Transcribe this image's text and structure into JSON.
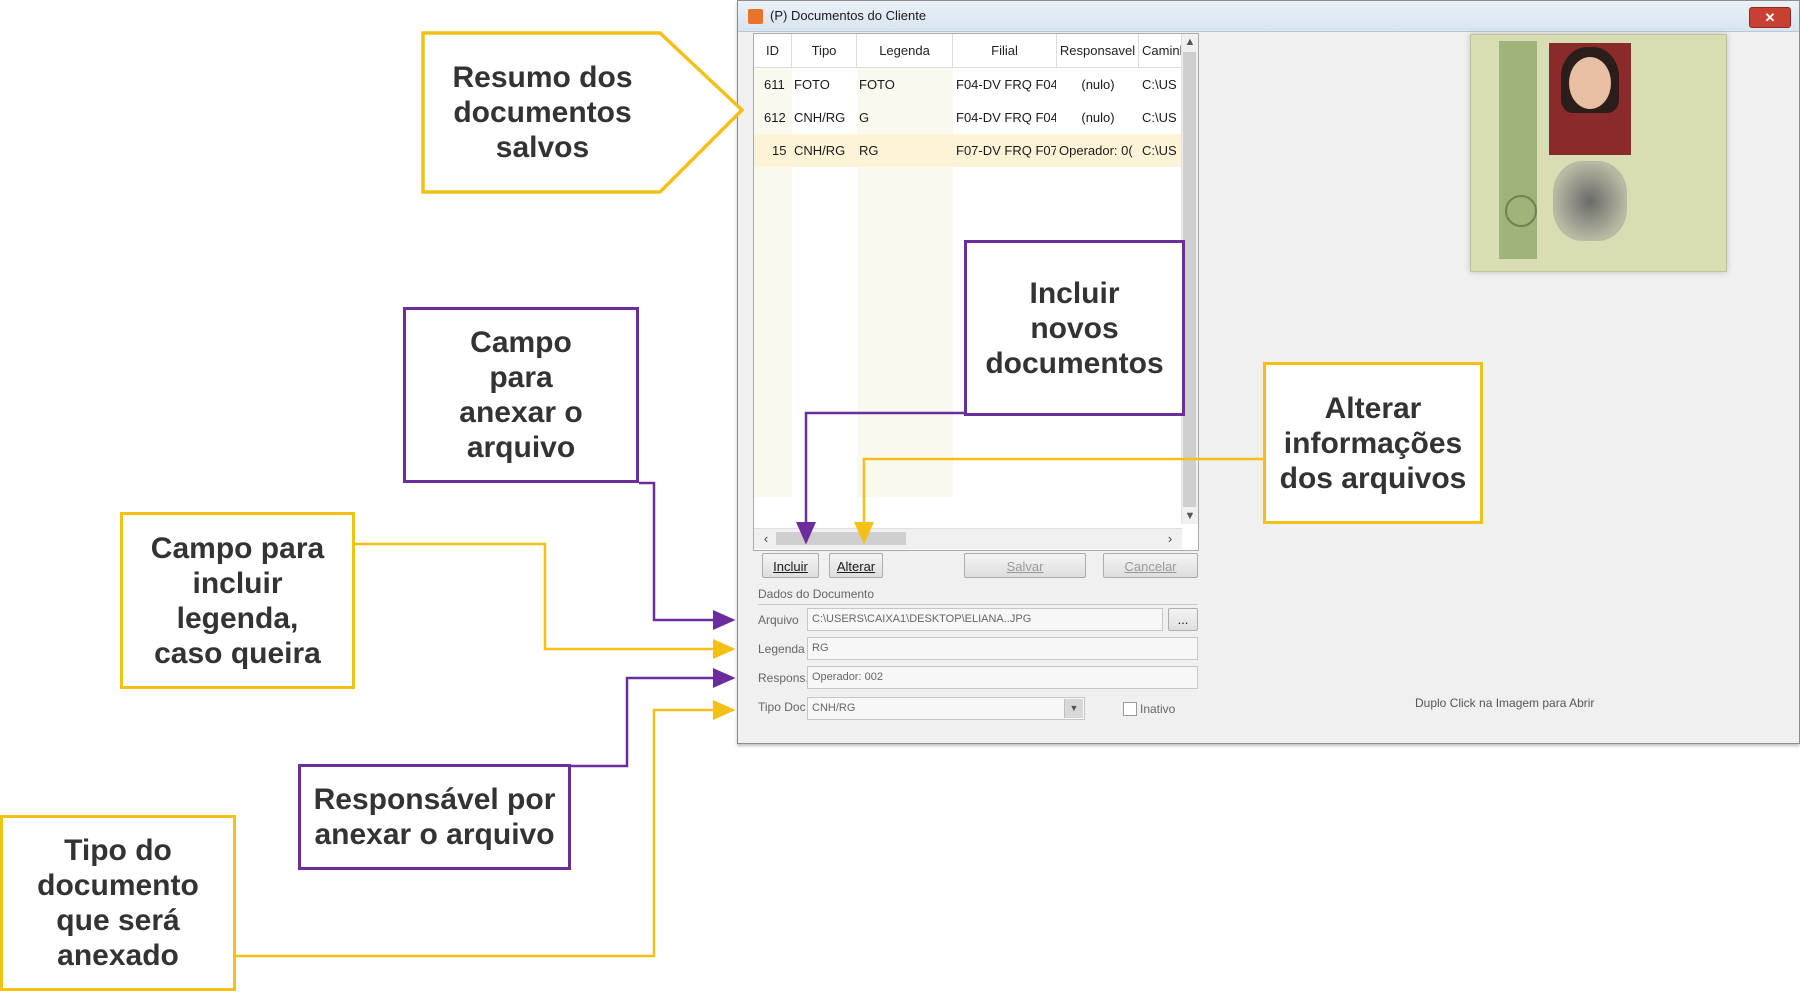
{
  "window": {
    "title": "(P) Documentos do Cliente",
    "close_label": "✕"
  },
  "grid": {
    "columns": [
      "ID",
      "Tipo",
      "Legenda",
      "Filial",
      "Responsavel",
      "Caminl"
    ],
    "rows": [
      {
        "id": "611",
        "tipo": "FOTO",
        "legenda": "FOTO",
        "filial": "F04-DV FRQ F04",
        "responsavel": "(nulo)",
        "caminho": "C:\\US"
      },
      {
        "id": "612",
        "tipo": "CNH/RG",
        "legenda": "G",
        "filial": "F04-DV FRQ F04",
        "responsavel": "(nulo)",
        "caminho": "C:\\US"
      },
      {
        "id": "15",
        "tipo": "CNH/RG",
        "legenda": "RG",
        "filial": "F07-DV FRQ F07",
        "responsavel": "Operador: 0(",
        "caminho": "C:\\US"
      }
    ],
    "selected_row": 2
  },
  "buttons": {
    "incluir": "Incluir",
    "alterar": "Alterar",
    "salvar": "Salvar",
    "cancelar": "Cancelar",
    "browse": "..."
  },
  "form": {
    "section_title": "Dados do Documento",
    "arquivo_label": "Arquivo",
    "arquivo_value": "C:\\USERS\\CAIXA1\\DESKTOP\\ELIANA..JPG",
    "legenda_label": "Legenda",
    "legenda_value": "RG",
    "respons_label": "Respons.",
    "respons_value": "Operador: 002",
    "tipodoc_label": "Tipo Doc",
    "tipodoc_value": "CNH/RG",
    "inativo_label": "Inativo",
    "inativo_checked": false
  },
  "image_hint": "Duplo Click na Imagem para Abrir",
  "callouts": {
    "resumo": "Resumo dos documentos salvos",
    "incluir_novos": "Incluir novos documentos",
    "alterar_info": "Alterar informações dos arquivos",
    "campo_anexar": "Campo para anexar o arquivo",
    "campo_legenda": "Campo para incluir legenda, caso queira",
    "responsavel": "Responsável por anexar o arquivo",
    "tipo_documento": "Tipo do documento que será anexado"
  },
  "colors": {
    "yellow": "#f4c018",
    "purple": "#6b2d9c",
    "selected_row": "#fdf4d8"
  }
}
